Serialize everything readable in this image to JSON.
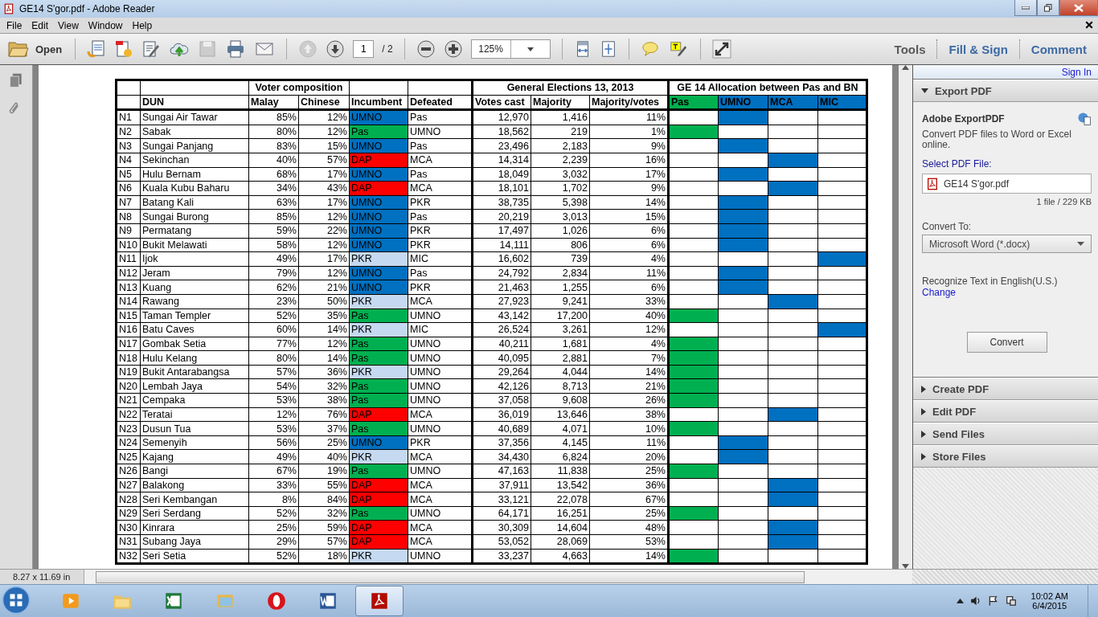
{
  "window": {
    "title": "GE14 S'gor.pdf - Adobe Reader"
  },
  "menu": [
    "File",
    "Edit",
    "View",
    "Window",
    "Help"
  ],
  "toolbar": {
    "open": "Open",
    "page_number": "1",
    "page_total": "/ 2",
    "zoom": "125%",
    "panes": [
      {
        "label": "Tools",
        "selected": true
      },
      {
        "label": "Fill & Sign",
        "selected": false
      },
      {
        "label": "Comment",
        "selected": false
      }
    ]
  },
  "table": {
    "group_headers": {
      "voter": "Voter composition",
      "ge13": "General Elections 13, 2013",
      "ge14": "GE 14 Allocation between Pas and BN"
    },
    "columns": [
      "DUN",
      "Malay",
      "Chinese",
      "Incumbent",
      "Defeated",
      "Votes cast",
      "Majority",
      "Majority/votes"
    ],
    "allocation_columns": [
      {
        "label": "Pas",
        "color": "#00b050"
      },
      {
        "label": "UMNO",
        "color": "#0070c0"
      },
      {
        "label": "MCA",
        "color": "#0070c0"
      },
      {
        "label": "MIC",
        "color": "#0070c0"
      }
    ],
    "rows": [
      {
        "code": "N1",
        "dun": "Sungai Air Tawar",
        "malay": "85%",
        "chinese": "12%",
        "incumbent": {
          "party": "UMNO",
          "color": "#0070c0"
        },
        "defeated": "Pas",
        "votes_cast": "12,970",
        "majority": "1,416",
        "majority_votes": "11%",
        "allocation": [
          false,
          true,
          false,
          false
        ]
      },
      {
        "code": "N2",
        "dun": "Sabak",
        "malay": "80%",
        "chinese": "12%",
        "incumbent": {
          "party": "Pas",
          "color": "#00b050"
        },
        "defeated": "UMNO",
        "votes_cast": "18,562",
        "majority": "219",
        "majority_votes": "1%",
        "allocation": [
          true,
          false,
          false,
          false
        ]
      },
      {
        "code": "N3",
        "dun": "Sungai Panjang",
        "malay": "83%",
        "chinese": "15%",
        "incumbent": {
          "party": "UMNO",
          "color": "#0070c0"
        },
        "defeated": "Pas",
        "votes_cast": "23,496",
        "majority": "2,183",
        "majority_votes": "9%",
        "allocation": [
          false,
          true,
          false,
          false
        ]
      },
      {
        "code": "N4",
        "dun": "Sekinchan",
        "malay": "40%",
        "chinese": "57%",
        "incumbent": {
          "party": "DAP",
          "color": "#ff0000"
        },
        "defeated": "MCA",
        "votes_cast": "14,314",
        "majority": "2,239",
        "majority_votes": "16%",
        "allocation": [
          false,
          false,
          true,
          false
        ]
      },
      {
        "code": "N5",
        "dun": "Hulu Bernam",
        "malay": "68%",
        "chinese": "17%",
        "incumbent": {
          "party": "UMNO",
          "color": "#0070c0"
        },
        "defeated": "Pas",
        "votes_cast": "18,049",
        "majority": "3,032",
        "majority_votes": "17%",
        "allocation": [
          false,
          true,
          false,
          false
        ]
      },
      {
        "code": "N6",
        "dun": "Kuala Kubu Baharu",
        "malay": "34%",
        "chinese": "43%",
        "incumbent": {
          "party": "DAP",
          "color": "#ff0000"
        },
        "defeated": "MCA",
        "votes_cast": "18,101",
        "majority": "1,702",
        "majority_votes": "9%",
        "allocation": [
          false,
          false,
          true,
          false
        ]
      },
      {
        "code": "N7",
        "dun": "Batang Kali",
        "malay": "63%",
        "chinese": "17%",
        "incumbent": {
          "party": "UMNO",
          "color": "#0070c0"
        },
        "defeated": "PKR",
        "votes_cast": "38,735",
        "majority": "5,398",
        "majority_votes": "14%",
        "allocation": [
          false,
          true,
          false,
          false
        ]
      },
      {
        "code": "N8",
        "dun": "Sungai Burong",
        "malay": "85%",
        "chinese": "12%",
        "incumbent": {
          "party": "UMNO",
          "color": "#0070c0"
        },
        "defeated": "Pas",
        "votes_cast": "20,219",
        "majority": "3,013",
        "majority_votes": "15%",
        "allocation": [
          false,
          true,
          false,
          false
        ]
      },
      {
        "code": "N9",
        "dun": "Permatang",
        "malay": "59%",
        "chinese": "22%",
        "incumbent": {
          "party": "UMNO",
          "color": "#0070c0"
        },
        "defeated": "PKR",
        "votes_cast": "17,497",
        "majority": "1,026",
        "majority_votes": "6%",
        "allocation": [
          false,
          true,
          false,
          false
        ]
      },
      {
        "code": "N10",
        "dun": "Bukit Melawati",
        "malay": "58%",
        "chinese": "12%",
        "incumbent": {
          "party": "UMNO",
          "color": "#0070c0"
        },
        "defeated": "PKR",
        "votes_cast": "14,111",
        "majority": "806",
        "majority_votes": "6%",
        "allocation": [
          false,
          true,
          false,
          false
        ]
      },
      {
        "code": "N11",
        "dun": "Ijok",
        "malay": "49%",
        "chinese": "17%",
        "incumbent": {
          "party": "PKR",
          "color": "#c5d9f1"
        },
        "defeated": "MIC",
        "votes_cast": "16,602",
        "majority": "739",
        "majority_votes": "4%",
        "allocation": [
          false,
          false,
          false,
          true
        ]
      },
      {
        "code": "N12",
        "dun": "Jeram",
        "malay": "79%",
        "chinese": "12%",
        "incumbent": {
          "party": "UMNO",
          "color": "#0070c0"
        },
        "defeated": "Pas",
        "votes_cast": "24,792",
        "majority": "2,834",
        "majority_votes": "11%",
        "allocation": [
          false,
          true,
          false,
          false
        ]
      },
      {
        "code": "N13",
        "dun": "Kuang",
        "malay": "62%",
        "chinese": "21%",
        "incumbent": {
          "party": "UMNO",
          "color": "#0070c0"
        },
        "defeated": "PKR",
        "votes_cast": "21,463",
        "majority": "1,255",
        "majority_votes": "6%",
        "allocation": [
          false,
          true,
          false,
          false
        ]
      },
      {
        "code": "N14",
        "dun": "Rawang",
        "malay": "23%",
        "chinese": "50%",
        "incumbent": {
          "party": "PKR",
          "color": "#c5d9f1"
        },
        "defeated": "MCA",
        "votes_cast": "27,923",
        "majority": "9,241",
        "majority_votes": "33%",
        "allocation": [
          false,
          false,
          true,
          false
        ]
      },
      {
        "code": "N15",
        "dun": "Taman Templer",
        "malay": "52%",
        "chinese": "35%",
        "incumbent": {
          "party": "Pas",
          "color": "#00b050"
        },
        "defeated": "UMNO",
        "votes_cast": "43,142",
        "majority": "17,200",
        "majority_votes": "40%",
        "allocation": [
          true,
          false,
          false,
          false
        ]
      },
      {
        "code": "N16",
        "dun": "Batu Caves",
        "malay": "60%",
        "chinese": "14%",
        "incumbent": {
          "party": "PKR",
          "color": "#c5d9f1"
        },
        "defeated": "MIC",
        "votes_cast": "26,524",
        "majority": "3,261",
        "majority_votes": "12%",
        "allocation": [
          false,
          false,
          false,
          true
        ]
      },
      {
        "code": "N17",
        "dun": "Gombak Setia",
        "malay": "77%",
        "chinese": "12%",
        "incumbent": {
          "party": "Pas",
          "color": "#00b050"
        },
        "defeated": "UMNO",
        "votes_cast": "40,211",
        "majority": "1,681",
        "majority_votes": "4%",
        "allocation": [
          true,
          false,
          false,
          false
        ]
      },
      {
        "code": "N18",
        "dun": "Hulu Kelang",
        "malay": "80%",
        "chinese": "14%",
        "incumbent": {
          "party": "Pas",
          "color": "#00b050"
        },
        "defeated": "UMNO",
        "votes_cast": "40,095",
        "majority": "2,881",
        "majority_votes": "7%",
        "allocation": [
          true,
          false,
          false,
          false
        ]
      },
      {
        "code": "N19",
        "dun": "Bukit Antarabangsa",
        "malay": "57%",
        "chinese": "36%",
        "incumbent": {
          "party": "PKR",
          "color": "#c5d9f1"
        },
        "defeated": "UMNO",
        "votes_cast": "29,264",
        "majority": "4,044",
        "majority_votes": "14%",
        "allocation": [
          true,
          false,
          false,
          false
        ]
      },
      {
        "code": "N20",
        "dun": "Lembah Jaya",
        "malay": "54%",
        "chinese": "32%",
        "incumbent": {
          "party": "Pas",
          "color": "#00b050"
        },
        "defeated": "UMNO",
        "votes_cast": "42,126",
        "majority": "8,713",
        "majority_votes": "21%",
        "allocation": [
          true,
          false,
          false,
          false
        ]
      },
      {
        "code": "N21",
        "dun": "Cempaka",
        "malay": "53%",
        "chinese": "38%",
        "incumbent": {
          "party": "Pas",
          "color": "#00b050"
        },
        "defeated": "UMNO",
        "votes_cast": "37,058",
        "majority": "9,608",
        "majority_votes": "26%",
        "allocation": [
          true,
          false,
          false,
          false
        ]
      },
      {
        "code": "N22",
        "dun": "Teratai",
        "malay": "12%",
        "chinese": "76%",
        "incumbent": {
          "party": "DAP",
          "color": "#ff0000"
        },
        "defeated": "MCA",
        "votes_cast": "36,019",
        "majority": "13,646",
        "majority_votes": "38%",
        "allocation": [
          false,
          false,
          true,
          false
        ]
      },
      {
        "code": "N23",
        "dun": "Dusun Tua",
        "malay": "53%",
        "chinese": "37%",
        "incumbent": {
          "party": "Pas",
          "color": "#00b050"
        },
        "defeated": "UMNO",
        "votes_cast": "40,689",
        "majority": "4,071",
        "majority_votes": "10%",
        "allocation": [
          true,
          false,
          false,
          false
        ]
      },
      {
        "code": "N24",
        "dun": "Semenyih",
        "malay": "56%",
        "chinese": "25%",
        "incumbent": {
          "party": "UMNO",
          "color": "#0070c0"
        },
        "defeated": "PKR",
        "votes_cast": "37,356",
        "majority": "4,145",
        "majority_votes": "11%",
        "allocation": [
          false,
          true,
          false,
          false
        ]
      },
      {
        "code": "N25",
        "dun": "Kajang",
        "malay": "49%",
        "chinese": "40%",
        "incumbent": {
          "party": "PKR",
          "color": "#c5d9f1"
        },
        "defeated": "MCA",
        "votes_cast": "34,430",
        "majority": "6,824",
        "majority_votes": "20%",
        "allocation": [
          false,
          true,
          false,
          false
        ]
      },
      {
        "code": "N26",
        "dun": "Bangi",
        "malay": "67%",
        "chinese": "19%",
        "incumbent": {
          "party": "Pas",
          "color": "#00b050"
        },
        "defeated": "UMNO",
        "votes_cast": "47,163",
        "majority": "11,838",
        "majority_votes": "25%",
        "allocation": [
          true,
          false,
          false,
          false
        ]
      },
      {
        "code": "N27",
        "dun": "Balakong",
        "malay": "33%",
        "chinese": "55%",
        "incumbent": {
          "party": "DAP",
          "color": "#ff0000"
        },
        "defeated": "MCA",
        "votes_cast": "37,911",
        "majority": "13,542",
        "majority_votes": "36%",
        "allocation": [
          false,
          false,
          true,
          false
        ]
      },
      {
        "code": "N28",
        "dun": "Seri Kembangan",
        "malay": "8%",
        "chinese": "84%",
        "incumbent": {
          "party": "DAP",
          "color": "#ff0000"
        },
        "defeated": "MCA",
        "votes_cast": "33,121",
        "majority": "22,078",
        "majority_votes": "67%",
        "allocation": [
          false,
          false,
          true,
          false
        ]
      },
      {
        "code": "N29",
        "dun": "Seri Serdang",
        "malay": "52%",
        "chinese": "32%",
        "incumbent": {
          "party": "Pas",
          "color": "#00b050"
        },
        "defeated": "UMNO",
        "votes_cast": "64,171",
        "majority": "16,251",
        "majority_votes": "25%",
        "allocation": [
          true,
          false,
          false,
          false
        ]
      },
      {
        "code": "N30",
        "dun": "Kinrara",
        "malay": "25%",
        "chinese": "59%",
        "incumbent": {
          "party": "DAP",
          "color": "#ff0000"
        },
        "defeated": "MCA",
        "votes_cast": "30,309",
        "majority": "14,604",
        "majority_votes": "48%",
        "allocation": [
          false,
          false,
          true,
          false
        ]
      },
      {
        "code": "N31",
        "dun": "Subang Jaya",
        "malay": "29%",
        "chinese": "57%",
        "incumbent": {
          "party": "DAP",
          "color": "#ff0000"
        },
        "defeated": "MCA",
        "votes_cast": "53,052",
        "majority": "28,069",
        "majority_votes": "53%",
        "allocation": [
          false,
          false,
          true,
          false
        ]
      },
      {
        "code": "N32",
        "dun": "Seri Setia",
        "malay": "52%",
        "chinese": "18%",
        "incumbent": {
          "party": "PKR",
          "color": "#c5d9f1"
        },
        "defeated": "UMNO",
        "votes_cast": "33,237",
        "majority": "4,663",
        "majority_votes": "14%",
        "allocation": [
          true,
          false,
          false,
          false
        ]
      }
    ]
  },
  "panel": {
    "sign_in": "Sign In",
    "sections": [
      {
        "title": "Export PDF",
        "expanded": true
      },
      {
        "title": "Create PDF",
        "expanded": false
      },
      {
        "title": "Edit PDF",
        "expanded": false
      },
      {
        "title": "Send Files",
        "expanded": false
      },
      {
        "title": "Store Files",
        "expanded": false
      }
    ],
    "export": {
      "heading": "Adobe ExportPDF",
      "description": "Convert PDF files to Word or Excel online.",
      "select_label": "Select PDF File:",
      "file": "GE14 S'gor.pdf",
      "file_info": "1 file / 229 KB",
      "convert_to_label": "Convert To:",
      "format": "Microsoft Word (*.docx)",
      "recognize": "Recognize Text in English(U.S.)",
      "change": "Change",
      "button": "Convert"
    }
  },
  "status_bar": {
    "page_size": "8.27 x 11.69 in"
  },
  "taskbar": {
    "apps": [
      {
        "kind": "media",
        "active": false
      },
      {
        "kind": "folder",
        "active": false
      },
      {
        "kind": "spreadsheet",
        "active": false
      },
      {
        "kind": "pictures",
        "active": false
      },
      {
        "kind": "browser",
        "active": false
      },
      {
        "kind": "word",
        "active": false
      },
      {
        "kind": "pdf",
        "active": true
      }
    ],
    "time": "10:02 AM",
    "date": "6/4/2015"
  }
}
